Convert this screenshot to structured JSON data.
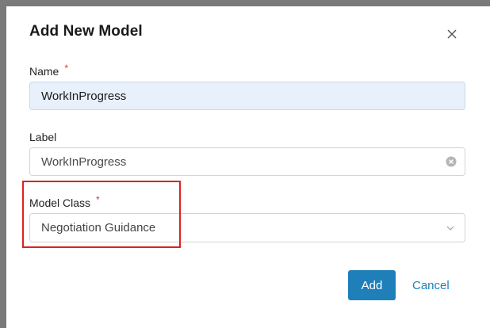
{
  "dialog": {
    "title": "Add New Model",
    "close_icon": "close-icon"
  },
  "fields": {
    "name": {
      "label": "Name",
      "required_mark": "*",
      "value": "WorkInProgress"
    },
    "label": {
      "label": "Label",
      "value": "WorkInProgress",
      "clear_icon": "clear-circle-icon"
    },
    "model_class": {
      "label": "Model Class",
      "required_mark": "*",
      "selected": "Negotiation Guidance",
      "chevron_icon": "chevron-down-icon"
    }
  },
  "actions": {
    "add_label": "Add",
    "cancel_label": "Cancel"
  },
  "colors": {
    "primary": "#1f7fb8",
    "required": "#e0342e",
    "highlight": "#e02020",
    "filled_input_bg": "#e8f0fb"
  }
}
